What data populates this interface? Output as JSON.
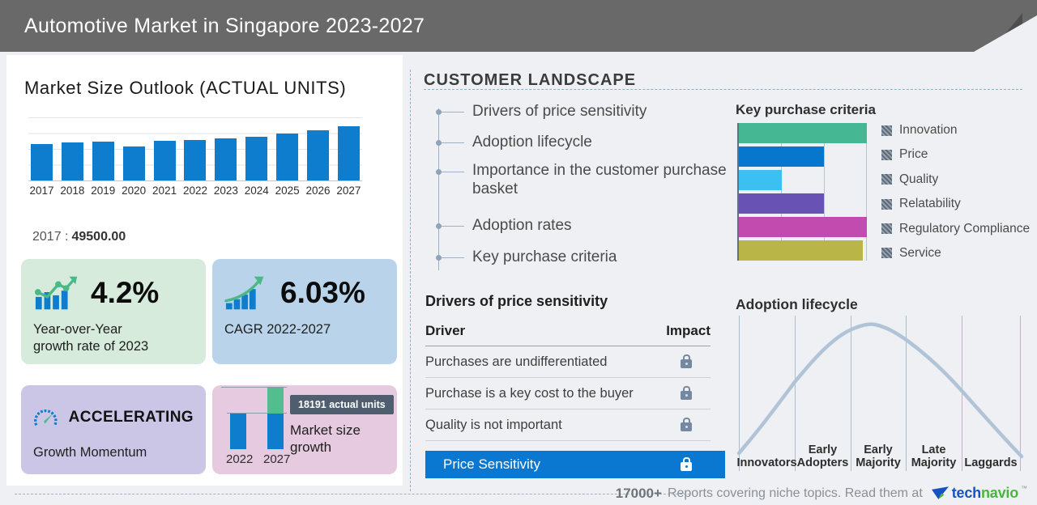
{
  "header": {
    "title": "Automotive Market in Singapore 2023-2027"
  },
  "left_panel": {
    "title": "Market Size Outlook (ACTUAL UNITS)",
    "base_year_label": "2017 :",
    "base_year_value": "49500.00",
    "yoy": {
      "value": "4.2%",
      "line1": "Year-over-Year",
      "line2": "growth rate of 2023"
    },
    "cagr": {
      "value": "6.03%",
      "label": "CAGR 2022-2027"
    },
    "momentum": {
      "status": "ACCELERATING",
      "label": "Growth Momentum"
    },
    "growth": {
      "badge": "18191 actual units",
      "line1": "Market size",
      "line2": "growth"
    }
  },
  "customer_landscape": {
    "title": "CUSTOMER  LANDSCAPE",
    "items": [
      "Drivers of price sensitivity",
      "Adoption lifecycle",
      "Importance in the customer purchase basket",
      "Adoption rates",
      "Key purchase criteria"
    ]
  },
  "drivers_table": {
    "title": "Drivers of price sensitivity",
    "col_driver": "Driver",
    "col_impact": "Impact",
    "rows": [
      "Purchases are undifferentiated",
      "Purchase is a key cost to the buyer",
      "Quality is not important"
    ],
    "highlight_row": "Price Sensitivity"
  },
  "footer": {
    "count": "17000+",
    "text": "Reports covering niche topics. Read them at",
    "logo_tech": "tech",
    "logo_navio": "navio",
    "tm": "™"
  },
  "colors": {
    "accent_blue": "#0e7dcd",
    "highlight_blue": "#0a78d1",
    "growth_green": "#52bd8e",
    "header_gray": "#696969"
  },
  "chart_data": [
    {
      "type": "bar",
      "title": "Market Size Outlook (ACTUAL UNITS)",
      "categories": [
        "2017",
        "2018",
        "2019",
        "2020",
        "2021",
        "2022",
        "2023",
        "2024",
        "2025",
        "2026",
        "2027"
      ],
      "values": [
        49500,
        51000,
        52100,
        45800,
        53600,
        54700,
        57000,
        59200,
        62900,
        67800,
        72900
      ],
      "note": "2017 labeled 49500.00 actual units; other values estimated from bar heights",
      "ylim": [
        0,
        85000
      ],
      "bar_color": "#0e7dcd",
      "grid": true
    },
    {
      "type": "bar",
      "orientation": "horizontal",
      "title": "Key purchase criteria",
      "categories": [
        "Innovation",
        "Price",
        "Quality",
        "Relatability",
        "Regulatory Compliance",
        "Service"
      ],
      "values": [
        3,
        2,
        1,
        2,
        3,
        2.9
      ],
      "xlim": [
        0,
        3
      ],
      "colors": [
        "#45b893",
        "#0677cd",
        "#3cc0f1",
        "#6852b3",
        "#c24bb0",
        "#b9b647"
      ],
      "legend_position": "right"
    },
    {
      "type": "line",
      "title": "Adoption lifecycle",
      "categories": [
        "Innovators",
        "Early Adopters",
        "Early Majority",
        "Late Majority",
        "Laggards"
      ],
      "shape": "bell curve peaking over early-majority boundary",
      "line_color": "#b1c4d7"
    },
    {
      "type": "bar",
      "title": "Market size growth",
      "categories": [
        "2022",
        "2027"
      ],
      "values": [
        54700,
        72891
      ],
      "annotation": "18191 actual units",
      "colors": [
        "#0e7dcd",
        "#52bd8e"
      ]
    }
  ]
}
